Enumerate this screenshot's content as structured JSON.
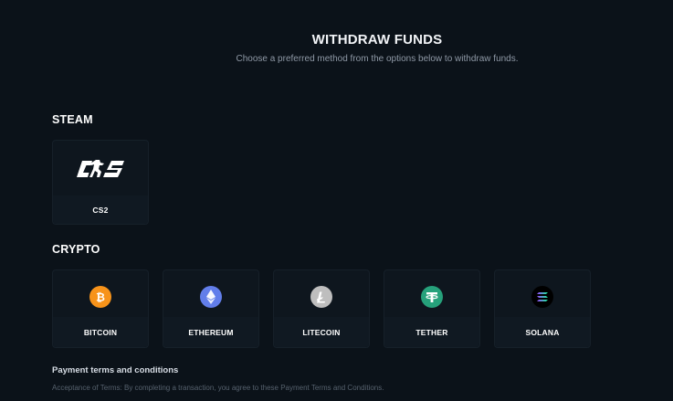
{
  "header": {
    "title": "WITHDRAW FUNDS",
    "subtitle": "Choose a preferred method from the options below to withdraw funds."
  },
  "steam": {
    "heading": "STEAM",
    "items": [
      {
        "label": "CS2",
        "logo_text": "CS",
        "icon": "cs2-logo-icon"
      }
    ]
  },
  "crypto": {
    "heading": "CRYPTO",
    "items": [
      {
        "label": "BITCOIN",
        "icon": "bitcoin-icon",
        "color": "#f7931a"
      },
      {
        "label": "ETHEREUM",
        "icon": "ethereum-icon",
        "color": "#627eea"
      },
      {
        "label": "LITECOIN",
        "icon": "litecoin-icon",
        "color": "#bebebe"
      },
      {
        "label": "TETHER",
        "icon": "tether-icon",
        "color": "#26a17b"
      },
      {
        "label": "SOLANA",
        "icon": "solana-icon",
        "color": "#000000"
      }
    ]
  },
  "terms": {
    "title": "Payment terms and conditions",
    "text": "Acceptance of Terms: By completing a transaction, you agree to these Payment Terms and Conditions."
  }
}
